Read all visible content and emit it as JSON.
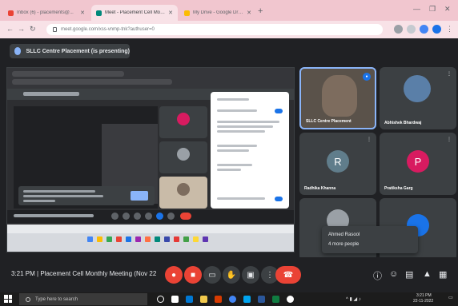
{
  "browser": {
    "tabs": [
      {
        "label": "Inbox (6) - placements@...",
        "color": "#ea4335"
      },
      {
        "label": "Meet - Placement Cell Monthly...",
        "color": "#00897b"
      },
      {
        "label": "My Drive - Google Drive",
        "color": "#fbbc04"
      }
    ],
    "url": "meet.google.com/xss-vnmp-tnk?authuser=0"
  },
  "meet": {
    "presenting_label": "SLLC Centre Placement (is presenting)",
    "meeting_time": "3:21 PM",
    "meeting_title": "Placement Cell Monthly Meeting (Nov 22",
    "meeting_separator": "|"
  },
  "participants": [
    {
      "name": "SLLC Centre Placement",
      "kind": "video",
      "self": true
    },
    {
      "name": "Abhishek Bhardwaj",
      "kind": "photo"
    },
    {
      "name": "Radhika Khanna",
      "initial": "R",
      "color": "#607d8b"
    },
    {
      "name": "Pratiksha Garg",
      "initial": "P",
      "color": "#d81b60"
    }
  ],
  "popup": {
    "line1": "Ahmed Rasool",
    "line2": "4 more people"
  },
  "taskbar": {
    "search_placeholder": "Type here to search",
    "time": "3:21 PM",
    "date": "22-11-2022"
  },
  "icons": {
    "mic": "mic-icon",
    "camera": "camera-icon",
    "captions": "cc-icon",
    "raise_hand": "hand-icon",
    "present": "present-icon",
    "more": "more-vert-icon",
    "end": "call-end-icon",
    "info": "info-icon",
    "people": "people-icon",
    "chat": "chat-icon",
    "activities": "activities-icon",
    "lock": "lock-icon"
  },
  "colors": {
    "chrome_tab_bg": "#f1c6cf",
    "meet_bg": "#202124",
    "end_call_red": "#ea4335",
    "accent_blue": "#1a73e8"
  }
}
